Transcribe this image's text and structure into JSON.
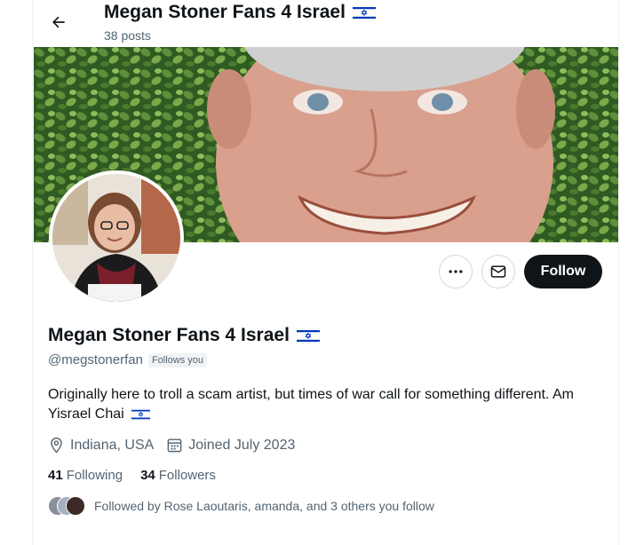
{
  "header": {
    "name": "Megan Stoner Fans 4 Israel",
    "posts": "38 posts"
  },
  "profile": {
    "name": "Megan Stoner Fans 4 Israel",
    "handle": "@megstonerfan",
    "follows_you": "Follows you",
    "bio": "Originally here to troll a scam artist, but times of war call for something different. Am Yisrael Chai",
    "location": "Indiana, USA",
    "joined": "Joined July 2023",
    "following_count": "41",
    "following_label": "Following",
    "followers_count": "34",
    "followers_label": "Followers",
    "followed_by": "Followed by Rose Laoutaris, amanda, and 3 others you follow"
  },
  "actions": {
    "follow_label": "Follow"
  },
  "icons": {
    "back": "arrow-left-icon",
    "more": "more-icon",
    "message": "envelope-icon",
    "location": "location-pin-icon",
    "calendar": "calendar-icon",
    "flag": "israel-flag-icon"
  },
  "colors": {
    "text": "#0f1419",
    "secondary": "#536471",
    "follow_bg": "#0f1419",
    "border": "#cfd9de",
    "flag_blue": "#0038b8"
  }
}
